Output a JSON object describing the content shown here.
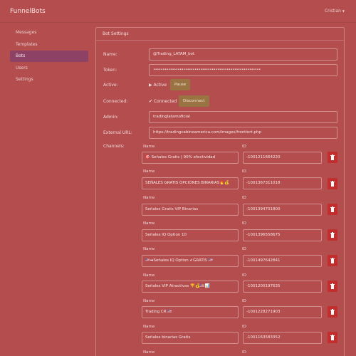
{
  "app": {
    "brand": "FunnelBots",
    "user_name": "Cristian"
  },
  "sidebar": {
    "items": [
      {
        "label": "Messages",
        "active": false
      },
      {
        "label": "Templates",
        "active": false
      },
      {
        "label": "Bots",
        "active": true
      },
      {
        "label": "Users",
        "active": false
      },
      {
        "label": "Settings",
        "active": false
      }
    ]
  },
  "panel": {
    "title": "Bot Settings"
  },
  "form": {
    "name_label": "Name:",
    "name_value": "@Trading_LATAM_bot",
    "token_label": "Token:",
    "token_value": "•••••••••••••••••••••••••••••••••••••••••••••••••••••••••",
    "active_label": "Active:",
    "active_status": "▶ Active",
    "pause_label": "Pause",
    "connected_label": "Connected:",
    "connected_status": "✔ Connected",
    "disconnect_label": "Disconnect",
    "admin_label": "Admin:",
    "admin_value": "tradinglatamoficial",
    "external_url_label": "External URL:",
    "external_url_value": "https://tradingcabinoamerica.com/images/frontiort.php",
    "channels_label": "Channels:"
  },
  "channels": {
    "name_header": "Name",
    "id_header": "ID",
    "items": [
      {
        "name": "🎯 Señales Gratis | 90% efectividad",
        "id": "-1001211664220"
      },
      {
        "name": "SEÑALES GRATIS OPCIONES BINARIAS🔥💰",
        "id": "-1001367311018"
      },
      {
        "name": "Señales Gratis VIP Binarias",
        "id": "-1001394701800"
      },
      {
        "name": "Señales IQ Option 10",
        "id": "-1001396558675"
      },
      {
        "name": "🇺🇸➡Señales IQ Option ✔GRATIS 🇺🇸",
        "id": "-1001497642841"
      },
      {
        "name": "Señales VIP Atractivas 🏆💰🇺🇸📊",
        "id": "-1001200197635"
      },
      {
        "name": "Trading CR 🇺🇸",
        "id": "-1001228271903"
      },
      {
        "name": "Señales binarias Gratis",
        "id": "-1001163583352"
      }
    ]
  }
}
